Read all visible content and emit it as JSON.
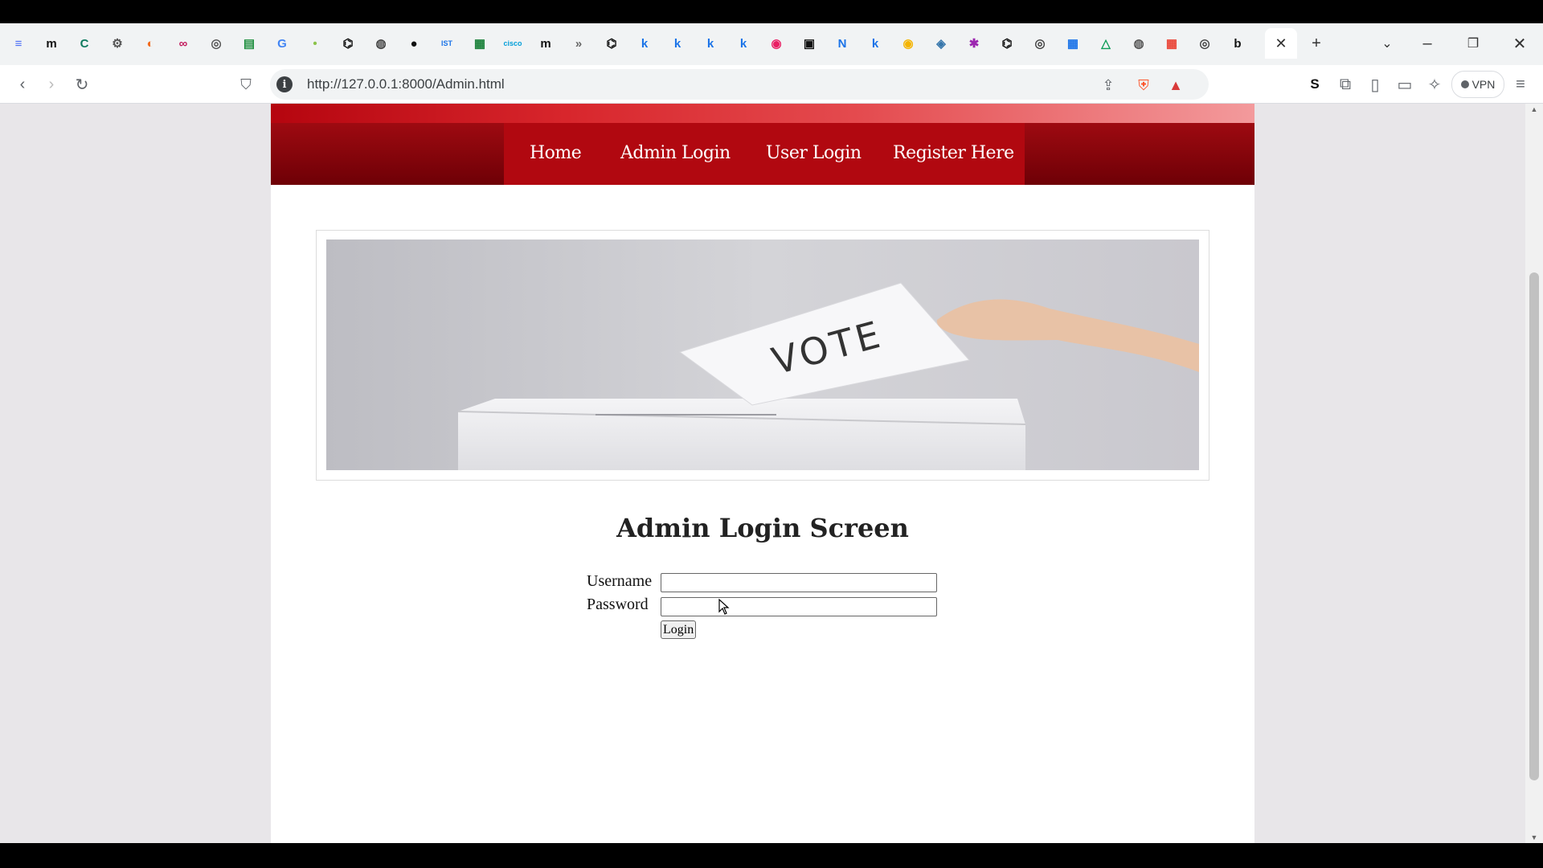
{
  "browser": {
    "active_tab_close": "✕",
    "new_tab": "+",
    "url": "http://127.0.0.1:8000/Admin.html",
    "vpn_label": "VPN",
    "tab_favicons": [
      "≡",
      "m",
      "C",
      "⚙",
      "◐",
      "∞",
      "◎",
      "▤",
      "G",
      "•",
      "⌬",
      "◍",
      "●",
      "IST",
      "▦",
      "cisco",
      "m",
      "»",
      "⌬",
      "k",
      "k",
      "k",
      "k",
      "◉",
      "▣",
      "N",
      "k",
      "◉",
      "◈",
      "✱",
      "⌬",
      "◎",
      "▦",
      "△",
      "◍",
      "▦",
      "◎",
      "b"
    ]
  },
  "site": {
    "nav": [
      "Home",
      "Admin Login",
      "User Login",
      "Register Here"
    ],
    "banner_text": "VOTE",
    "title": "Admin Login Screen",
    "form": {
      "username_label": "Username",
      "password_label": "Password",
      "username_value": "",
      "password_value": "",
      "submit_label": "Login"
    }
  },
  "colors": {
    "nav_bg": "#9e0a11",
    "nav_active": "#b10810",
    "page_bg": "#e8e6e9"
  }
}
